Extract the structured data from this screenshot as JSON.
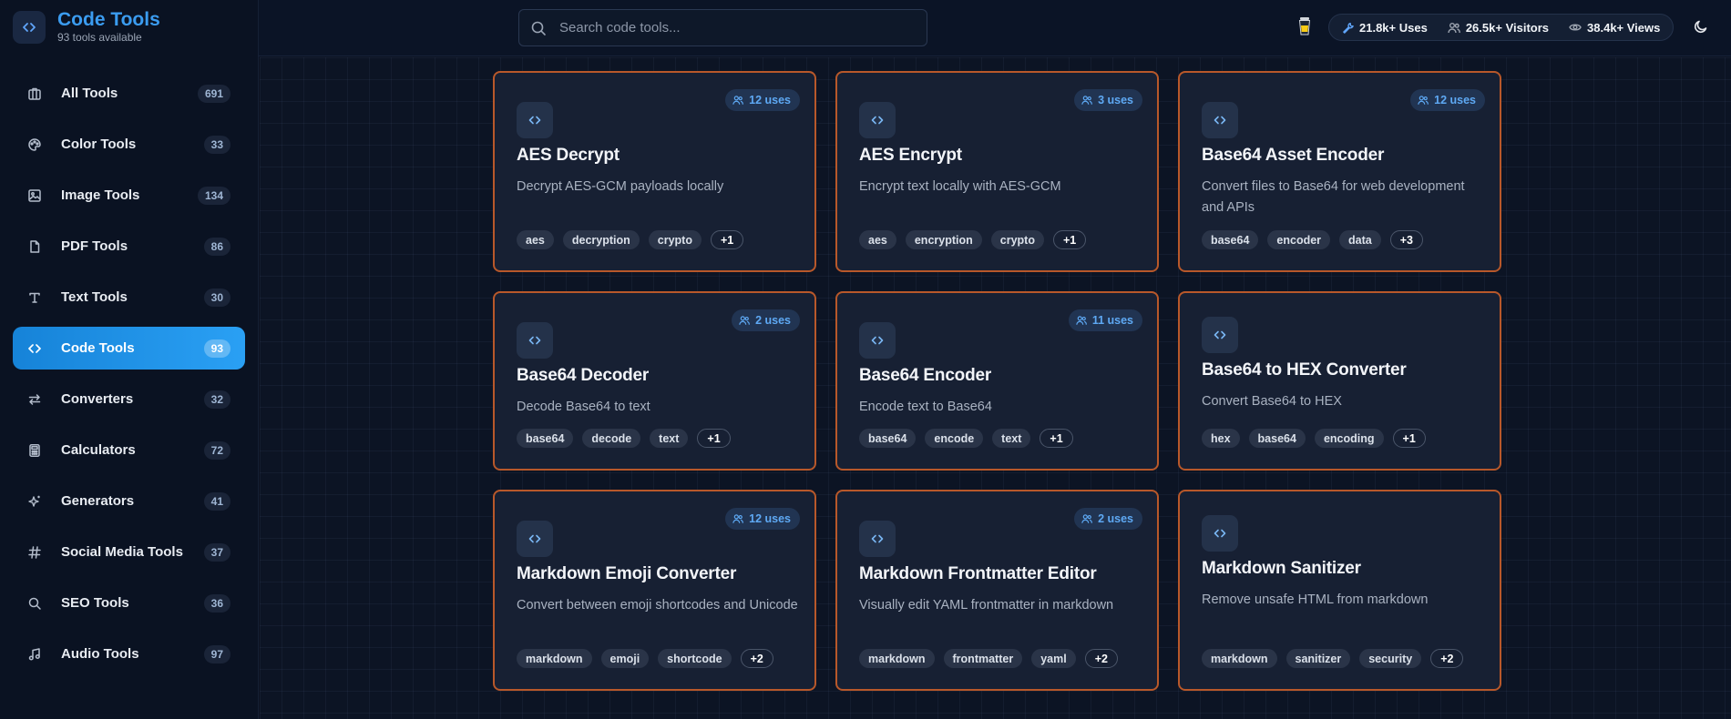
{
  "brand": {
    "title": "Code Tools",
    "subtitle": "93 tools available"
  },
  "search": {
    "placeholder": "Search code tools..."
  },
  "stats": {
    "uses": "21.8k+ Uses",
    "visitors": "26.5k+ Visitors",
    "views": "38.4k+ Views"
  },
  "colors": {
    "accent": "#2aa0f4",
    "card_border": "#b8582a",
    "background": "#0b1120"
  },
  "nav": [
    {
      "label": "All Tools",
      "count": "691",
      "icon": "grid-icon"
    },
    {
      "label": "Color Tools",
      "count": "33",
      "icon": "palette-icon"
    },
    {
      "label": "Image Tools",
      "count": "134",
      "icon": "image-icon"
    },
    {
      "label": "PDF Tools",
      "count": "86",
      "icon": "file-icon"
    },
    {
      "label": "Text Tools",
      "count": "30",
      "icon": "text-icon"
    },
    {
      "label": "Code Tools",
      "count": "93",
      "icon": "code-icon",
      "active": true
    },
    {
      "label": "Converters",
      "count": "32",
      "icon": "swap-icon"
    },
    {
      "label": "Calculators",
      "count": "72",
      "icon": "calculator-icon"
    },
    {
      "label": "Generators",
      "count": "41",
      "icon": "sparkle-icon"
    },
    {
      "label": "Social Media Tools",
      "count": "37",
      "icon": "hash-icon"
    },
    {
      "label": "SEO Tools",
      "count": "36",
      "icon": "search-icon"
    },
    {
      "label": "Audio Tools",
      "count": "97",
      "icon": "music-icon"
    }
  ],
  "cards": [
    {
      "title": "AES Decrypt",
      "description": "Decrypt AES-GCM payloads locally",
      "uses": "12 uses",
      "tags": [
        "aes",
        "decryption",
        "crypto"
      ],
      "more": "+1"
    },
    {
      "title": "AES Encrypt",
      "description": "Encrypt text locally with AES-GCM",
      "uses": "3 uses",
      "tags": [
        "aes",
        "encryption",
        "crypto"
      ],
      "more": "+1"
    },
    {
      "title": "Base64 Asset Encoder",
      "description": "Convert files to Base64 for web development and APIs",
      "uses": "12 uses",
      "tags": [
        "base64",
        "encoder",
        "data"
      ],
      "more": "+3"
    },
    {
      "title": "Base64 Decoder",
      "description": "Decode Base64 to text",
      "uses": "2 uses",
      "tags": [
        "base64",
        "decode",
        "text"
      ],
      "more": "+1"
    },
    {
      "title": "Base64 Encoder",
      "description": "Encode text to Base64",
      "uses": "11 uses",
      "tags": [
        "base64",
        "encode",
        "text"
      ],
      "more": "+1"
    },
    {
      "title": "Base64 to HEX Converter",
      "description": "Convert Base64 to HEX",
      "uses": "",
      "tags": [
        "hex",
        "base64",
        "encoding"
      ],
      "more": "+1"
    },
    {
      "title": "Markdown Emoji Converter",
      "description": "Convert between emoji shortcodes and Unicode",
      "uses": "12 uses",
      "tags": [
        "markdown",
        "emoji",
        "shortcode"
      ],
      "more": "+2"
    },
    {
      "title": "Markdown Frontmatter Editor",
      "description": "Visually edit YAML frontmatter in markdown",
      "uses": "2 uses",
      "tags": [
        "markdown",
        "frontmatter",
        "yaml"
      ],
      "more": "+2"
    },
    {
      "title": "Markdown Sanitizer",
      "description": "Remove unsafe HTML from markdown",
      "uses": "",
      "tags": [
        "markdown",
        "sanitizer",
        "security"
      ],
      "more": "+2"
    }
  ]
}
